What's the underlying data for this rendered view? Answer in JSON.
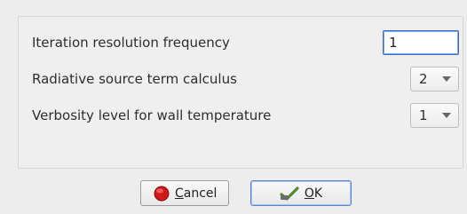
{
  "rows": [
    {
      "label": "Iteration resolution frequency",
      "control": "text",
      "value": "1"
    },
    {
      "label": "Radiative source term calculus",
      "control": "combo",
      "value": "2"
    },
    {
      "label": "Verbosity level for wall temperature",
      "control": "combo",
      "value": "1"
    }
  ],
  "buttons": {
    "cancel": {
      "mnemonic": "C",
      "rest": "ancel",
      "icon": "stop-icon"
    },
    "ok": {
      "mnemonic": "O",
      "rest": "K",
      "icon": "check-icon"
    }
  },
  "colors": {
    "cancel_icon": "#d01818",
    "ok_icon": "#4f8a2e",
    "focus_border": "#3f6fbf"
  }
}
